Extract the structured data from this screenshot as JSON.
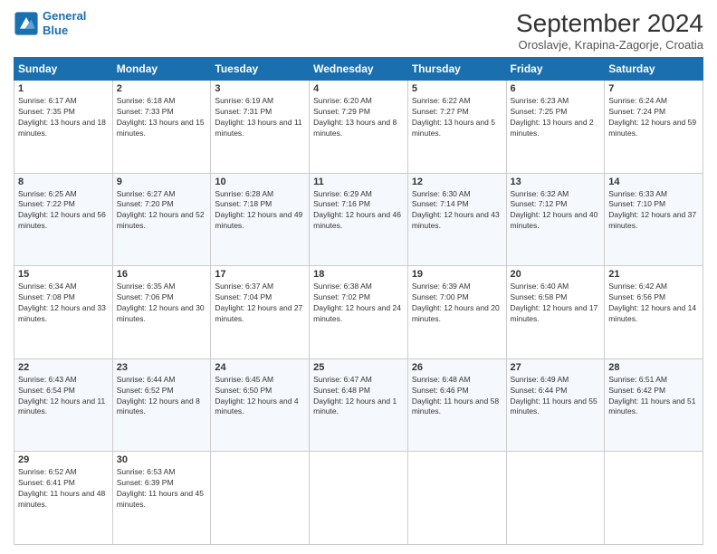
{
  "logo": {
    "line1": "General",
    "line2": "Blue"
  },
  "header": {
    "month": "September 2024",
    "location": "Oroslavje, Krapina-Zagorje, Croatia"
  },
  "days_of_week": [
    "Sunday",
    "Monday",
    "Tuesday",
    "Wednesday",
    "Thursday",
    "Friday",
    "Saturday"
  ],
  "weeks": [
    [
      {
        "day": "1",
        "info": "Sunrise: 6:17 AM\nSunset: 7:35 PM\nDaylight: 13 hours and 18 minutes."
      },
      {
        "day": "2",
        "info": "Sunrise: 6:18 AM\nSunset: 7:33 PM\nDaylight: 13 hours and 15 minutes."
      },
      {
        "day": "3",
        "info": "Sunrise: 6:19 AM\nSunset: 7:31 PM\nDaylight: 13 hours and 11 minutes."
      },
      {
        "day": "4",
        "info": "Sunrise: 6:20 AM\nSunset: 7:29 PM\nDaylight: 13 hours and 8 minutes."
      },
      {
        "day": "5",
        "info": "Sunrise: 6:22 AM\nSunset: 7:27 PM\nDaylight: 13 hours and 5 minutes."
      },
      {
        "day": "6",
        "info": "Sunrise: 6:23 AM\nSunset: 7:25 PM\nDaylight: 13 hours and 2 minutes."
      },
      {
        "day": "7",
        "info": "Sunrise: 6:24 AM\nSunset: 7:24 PM\nDaylight: 12 hours and 59 minutes."
      }
    ],
    [
      {
        "day": "8",
        "info": "Sunrise: 6:25 AM\nSunset: 7:22 PM\nDaylight: 12 hours and 56 minutes."
      },
      {
        "day": "9",
        "info": "Sunrise: 6:27 AM\nSunset: 7:20 PM\nDaylight: 12 hours and 52 minutes."
      },
      {
        "day": "10",
        "info": "Sunrise: 6:28 AM\nSunset: 7:18 PM\nDaylight: 12 hours and 49 minutes."
      },
      {
        "day": "11",
        "info": "Sunrise: 6:29 AM\nSunset: 7:16 PM\nDaylight: 12 hours and 46 minutes."
      },
      {
        "day": "12",
        "info": "Sunrise: 6:30 AM\nSunset: 7:14 PM\nDaylight: 12 hours and 43 minutes."
      },
      {
        "day": "13",
        "info": "Sunrise: 6:32 AM\nSunset: 7:12 PM\nDaylight: 12 hours and 40 minutes."
      },
      {
        "day": "14",
        "info": "Sunrise: 6:33 AM\nSunset: 7:10 PM\nDaylight: 12 hours and 37 minutes."
      }
    ],
    [
      {
        "day": "15",
        "info": "Sunrise: 6:34 AM\nSunset: 7:08 PM\nDaylight: 12 hours and 33 minutes."
      },
      {
        "day": "16",
        "info": "Sunrise: 6:35 AM\nSunset: 7:06 PM\nDaylight: 12 hours and 30 minutes."
      },
      {
        "day": "17",
        "info": "Sunrise: 6:37 AM\nSunset: 7:04 PM\nDaylight: 12 hours and 27 minutes."
      },
      {
        "day": "18",
        "info": "Sunrise: 6:38 AM\nSunset: 7:02 PM\nDaylight: 12 hours and 24 minutes."
      },
      {
        "day": "19",
        "info": "Sunrise: 6:39 AM\nSunset: 7:00 PM\nDaylight: 12 hours and 20 minutes."
      },
      {
        "day": "20",
        "info": "Sunrise: 6:40 AM\nSunset: 6:58 PM\nDaylight: 12 hours and 17 minutes."
      },
      {
        "day": "21",
        "info": "Sunrise: 6:42 AM\nSunset: 6:56 PM\nDaylight: 12 hours and 14 minutes."
      }
    ],
    [
      {
        "day": "22",
        "info": "Sunrise: 6:43 AM\nSunset: 6:54 PM\nDaylight: 12 hours and 11 minutes."
      },
      {
        "day": "23",
        "info": "Sunrise: 6:44 AM\nSunset: 6:52 PM\nDaylight: 12 hours and 8 minutes."
      },
      {
        "day": "24",
        "info": "Sunrise: 6:45 AM\nSunset: 6:50 PM\nDaylight: 12 hours and 4 minutes."
      },
      {
        "day": "25",
        "info": "Sunrise: 6:47 AM\nSunset: 6:48 PM\nDaylight: 12 hours and 1 minute."
      },
      {
        "day": "26",
        "info": "Sunrise: 6:48 AM\nSunset: 6:46 PM\nDaylight: 11 hours and 58 minutes."
      },
      {
        "day": "27",
        "info": "Sunrise: 6:49 AM\nSunset: 6:44 PM\nDaylight: 11 hours and 55 minutes."
      },
      {
        "day": "28",
        "info": "Sunrise: 6:51 AM\nSunset: 6:42 PM\nDaylight: 11 hours and 51 minutes."
      }
    ],
    [
      {
        "day": "29",
        "info": "Sunrise: 6:52 AM\nSunset: 6:41 PM\nDaylight: 11 hours and 48 minutes."
      },
      {
        "day": "30",
        "info": "Sunrise: 6:53 AM\nSunset: 6:39 PM\nDaylight: 11 hours and 45 minutes."
      },
      {
        "day": "",
        "info": ""
      },
      {
        "day": "",
        "info": ""
      },
      {
        "day": "",
        "info": ""
      },
      {
        "day": "",
        "info": ""
      },
      {
        "day": "",
        "info": ""
      }
    ]
  ]
}
